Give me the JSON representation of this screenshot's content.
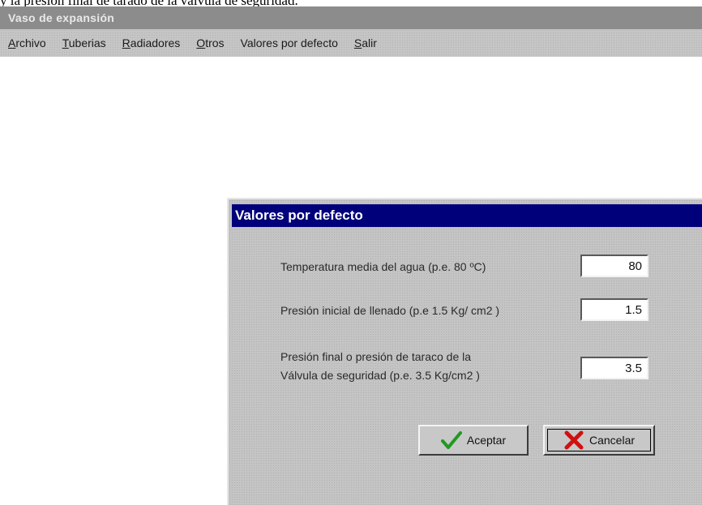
{
  "page": {
    "caption": "y la presión final de tarado de la válvula de seguridad."
  },
  "app": {
    "title": "Vaso de expansión"
  },
  "menu": [
    {
      "mnemonic": "A",
      "rest": "rchivo"
    },
    {
      "mnemonic": "T",
      "rest": "uberias"
    },
    {
      "mnemonic": "R",
      "rest": "adiadores"
    },
    {
      "mnemonic": "O",
      "rest": "tros"
    },
    {
      "mnemonic": "",
      "rest": "Valores por defecto"
    },
    {
      "mnemonic": "S",
      "rest": "alir"
    }
  ],
  "dialog": {
    "title": "Valores por defecto",
    "fields": [
      {
        "label": "Temperatura media del agua (p.e. 80 ºC)",
        "value": "80"
      },
      {
        "label": "Presión inicial de llenado (p.e 1.5 Kg/ cm2 )",
        "value": "1.5"
      },
      {
        "label_line1": "Presión final o presión de taraco de la",
        "label_line2": "Válvula de seguridad  (p.e. 3.5 Kg/cm2 )",
        "value": "3.5"
      }
    ],
    "buttons": {
      "ok_label": "Aceptar",
      "ok_icon": "checkmark-icon",
      "cancel_label": "Cancelar",
      "cancel_icon": "x-icon"
    }
  },
  "colors": {
    "dialog_title_bg": "#00007a",
    "check_green": "#1f9a1f",
    "cancel_red": "#d01010"
  }
}
